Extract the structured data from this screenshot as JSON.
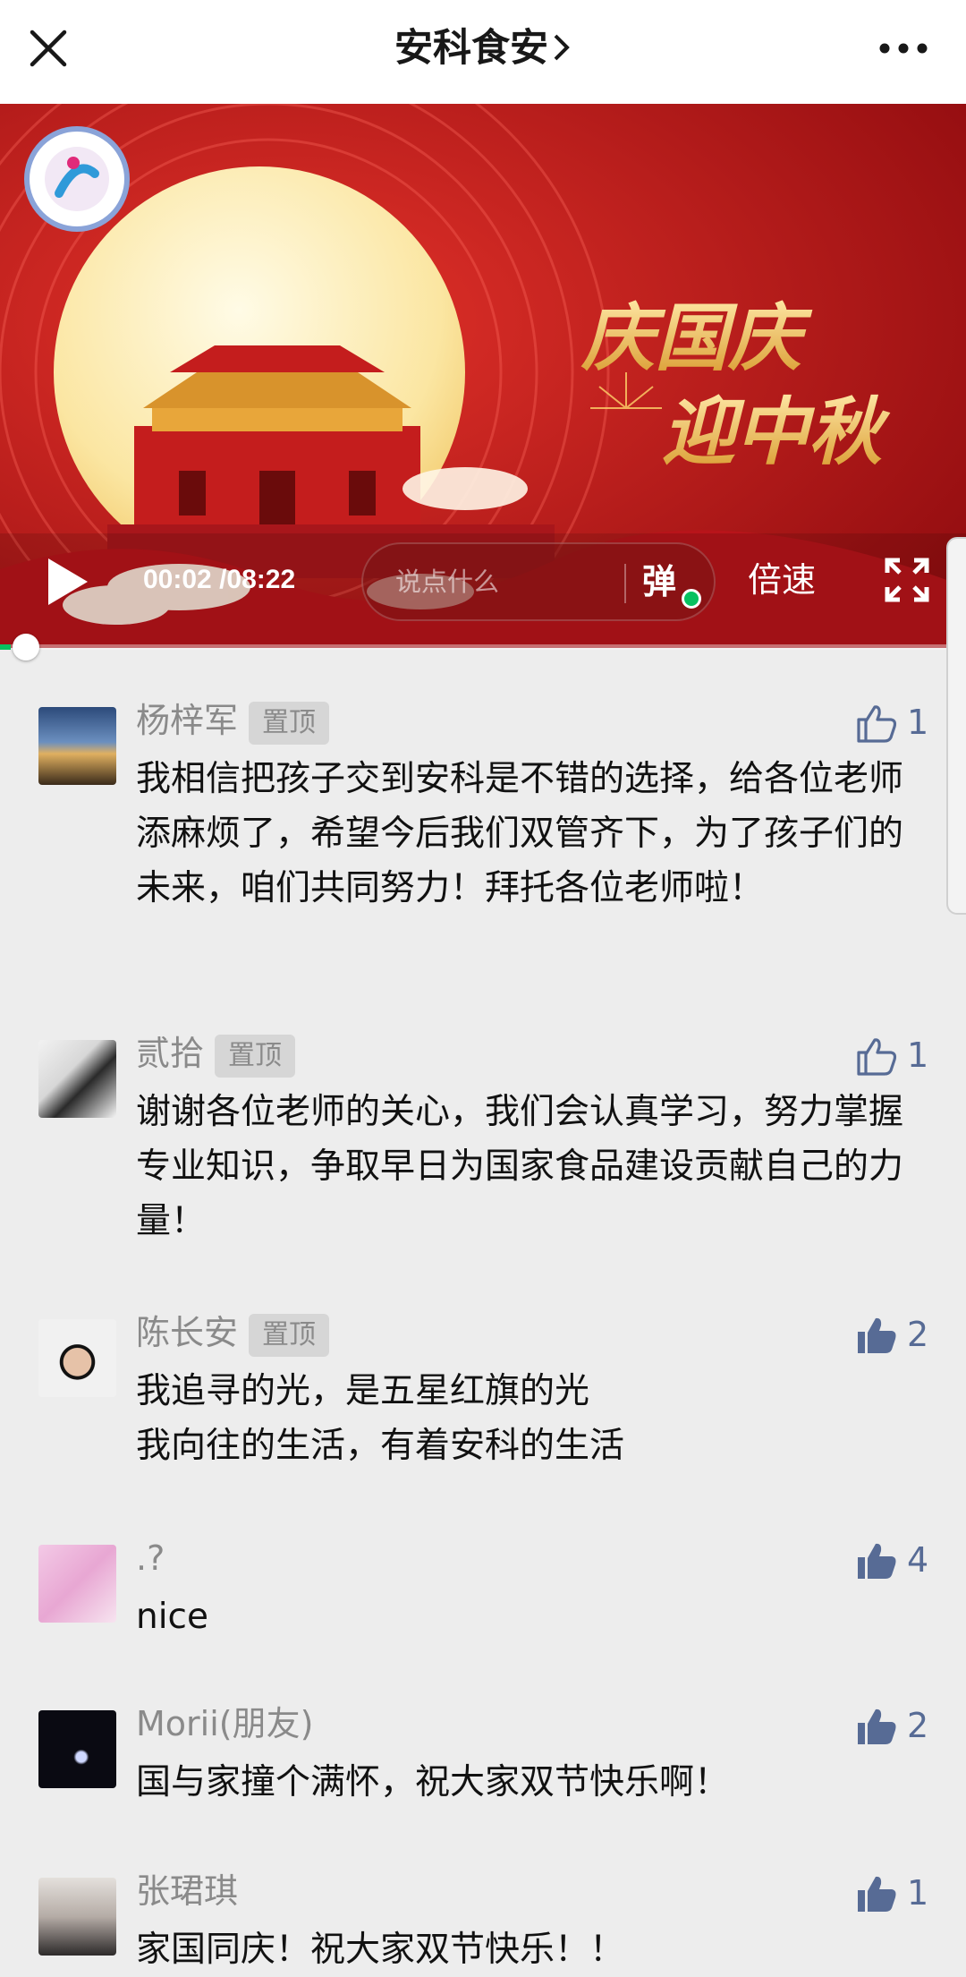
{
  "nav": {
    "title": "安科食安",
    "close_icon": "close-icon",
    "more_icon": "more-dots-icon"
  },
  "video": {
    "banner_line1": "庆国庆",
    "banner_line2": "迎中秋",
    "current_time": "00:02",
    "duration": "/08:22",
    "danmu_placeholder": "说点什么",
    "danmu_toggle": "弹",
    "speed_label": "倍速",
    "progress_fraction": 0.004,
    "accent_color": "#07c160"
  },
  "comments": [
    {
      "name": "杨梓军",
      "pinned": "置顶",
      "likes": "1",
      "liked": false,
      "text": "我相信把孩子交到安科是不错的选择，给各位老师添麻烦了，希望今后我们双管齐下，为了孩子们的未来，咱们共同努力！拜托各位老师啦！"
    },
    {
      "name": "贰拾",
      "pinned": "置顶",
      "likes": "1",
      "liked": false,
      "text": "谢谢各位老师的关心，我们会认真学习，努力掌握专业知识，争取早日为国家食品建设贡献自己的力量！"
    },
    {
      "name": "陈长安",
      "pinned": "置顶",
      "likes": "2",
      "liked": true,
      "text": "我追寻的光，是五星红旗的光\n我向往的生活，有着安科的生活"
    },
    {
      "name": ".?",
      "pinned": "",
      "likes": "4",
      "liked": true,
      "text": "nice"
    },
    {
      "name": "Morii(朋友)",
      "pinned": "",
      "likes": "2",
      "liked": true,
      "text": "国与家撞个满怀，祝大家双节快乐啊！"
    },
    {
      "name": "张珺琪",
      "pinned": "",
      "likes": "1",
      "liked": true,
      "text": "家国同庆！祝大家双节快乐！！"
    }
  ],
  "like_color": "#576b95"
}
